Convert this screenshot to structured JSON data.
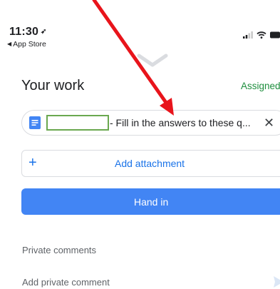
{
  "status_bar": {
    "time": "11:30",
    "location_arrow": "➶",
    "back_label": "App Store",
    "back_icon": "back-triangle-icon"
  },
  "sheet": {
    "title": "Your work",
    "status": "Assigned"
  },
  "attachment": {
    "name": "- Fill in the answers to these q...",
    "icon": "google-docs-icon",
    "remove_icon": "close-icon",
    "remove_glyph": "✕"
  },
  "add_attachment": {
    "glyph": "+",
    "label": "Add attachment"
  },
  "hand_in": {
    "label": "Hand in"
  },
  "private_comments": {
    "title": "Private comments",
    "placeholder": "Add private comment"
  },
  "colors": {
    "accent_blue": "#1a73e8",
    "button_blue": "#4285f4",
    "assigned_green": "#1e8e3e",
    "annotation_red": "#e8141b",
    "redaction_green": "#6aa84f"
  }
}
